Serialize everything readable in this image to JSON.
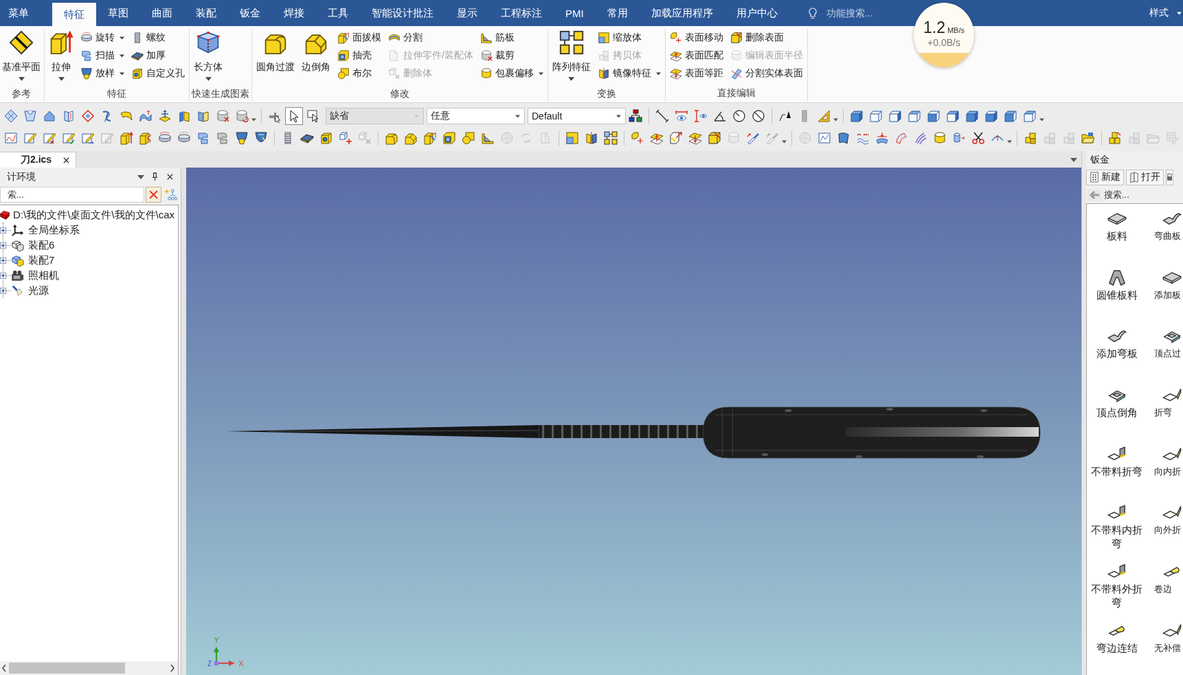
{
  "menubar": {
    "tabs": [
      {
        "label": "菜单",
        "selected": false
      },
      {
        "label": "特征",
        "selected": true
      },
      {
        "label": "草图",
        "selected": false
      },
      {
        "label": "曲面",
        "selected": false
      },
      {
        "label": "装配",
        "selected": false
      },
      {
        "label": "钣金",
        "selected": false
      },
      {
        "label": "焊接",
        "selected": false
      },
      {
        "label": "工具",
        "selected": false
      },
      {
        "label": "智能设计批注",
        "selected": false
      },
      {
        "label": "显示",
        "selected": false
      },
      {
        "label": "工程标注",
        "selected": false
      },
      {
        "label": "PMI",
        "selected": false
      },
      {
        "label": "常用",
        "selected": false
      },
      {
        "label": "加载应用程序",
        "selected": false
      },
      {
        "label": "用户中心",
        "selected": false
      }
    ],
    "search": {
      "placeholder": "功能搜索..."
    },
    "style_menu": {
      "label": "样式"
    }
  },
  "speed_meter": {
    "rate": "1.2",
    "unit": "MB/s",
    "change": "+0.0B/s",
    "level": 0.22
  },
  "ribbon": {
    "groups": [
      {
        "label": "参考",
        "items": [
          {
            "kind": "large",
            "label": "基准平面",
            "menu": true,
            "disabled": false
          }
        ]
      },
      {
        "label": "特征",
        "items": [
          {
            "kind": "large",
            "label": "拉伸",
            "menu": true,
            "disabled": false
          },
          {
            "kind": "small",
            "label": "旋转",
            "menu": true,
            "disabled": false
          },
          {
            "kind": "small",
            "label": "扫描",
            "menu": true,
            "disabled": false
          },
          {
            "kind": "small",
            "label": "放样",
            "menu": true,
            "disabled": false
          },
          {
            "kind": "small",
            "label": "螺纹",
            "menu": false,
            "disabled": false
          },
          {
            "kind": "small",
            "label": "加厚",
            "menu": false,
            "disabled": false
          },
          {
            "kind": "small",
            "label": "自定义孔",
            "menu": false,
            "disabled": false
          }
        ]
      },
      {
        "label": "快速生成图素",
        "items": [
          {
            "kind": "large",
            "label": "长方体",
            "menu": true,
            "disabled": false
          }
        ]
      },
      {
        "label": "修改",
        "items": [
          {
            "kind": "large",
            "label": "圆角过渡",
            "menu": false,
            "disabled": false
          },
          {
            "kind": "large",
            "label": "边倒角",
            "menu": false,
            "disabled": false
          },
          {
            "kind": "small",
            "label": "面拔模",
            "menu": false,
            "disabled": false
          },
          {
            "kind": "small",
            "label": "抽壳",
            "menu": false,
            "disabled": false
          },
          {
            "kind": "small",
            "label": "布尔",
            "menu": false,
            "disabled": false
          },
          {
            "kind": "small",
            "label": "分割",
            "menu": false,
            "disabled": false
          },
          {
            "kind": "small",
            "label": "拉伸零件/装配体",
            "menu": false,
            "disabled": true
          },
          {
            "kind": "small",
            "label": "删除体",
            "menu": false,
            "disabled": true
          },
          {
            "kind": "small",
            "label": "筋板",
            "menu": false,
            "disabled": false
          },
          {
            "kind": "small",
            "label": "裁剪",
            "menu": false,
            "disabled": false
          },
          {
            "kind": "small",
            "label": "包裹偏移",
            "menu": true,
            "disabled": false
          }
        ]
      },
      {
        "label": "变换",
        "items": [
          {
            "kind": "large",
            "label": "阵列特征",
            "menu": true,
            "disabled": false
          },
          {
            "kind": "small",
            "label": "缩放体",
            "menu": false,
            "disabled": false
          },
          {
            "kind": "small",
            "label": "拷贝体",
            "menu": false,
            "disabled": true
          },
          {
            "kind": "small",
            "label": "镜像特征",
            "menu": true,
            "disabled": false
          }
        ]
      },
      {
        "label": "直接编辑",
        "items": [
          {
            "kind": "small",
            "label": "表面移动",
            "menu": false,
            "disabled": false
          },
          {
            "kind": "small",
            "label": "表面匹配",
            "menu": false,
            "disabled": false
          },
          {
            "kind": "small",
            "label": "表面等距",
            "menu": false,
            "disabled": false
          },
          {
            "kind": "small",
            "label": "删除表面",
            "menu": false,
            "disabled": false
          },
          {
            "kind": "small",
            "label": "编辑表面半径",
            "menu": false,
            "disabled": true
          },
          {
            "kind": "small",
            "label": "分割实体表面",
            "menu": false,
            "disabled": false
          }
        ]
      }
    ]
  },
  "toolbar_rows": [
    {
      "segments": [
        {
          "kind": "icons",
          "menu": true,
          "buttons": [
            {
              "disabled": false
            },
            {
              "disabled": false
            },
            {
              "disabled": false
            },
            {
              "disabled": false
            },
            {
              "disabled": false
            },
            {
              "disabled": false
            },
            {
              "disabled": false
            },
            {
              "disabled": false
            },
            {
              "disabled": false
            },
            {
              "disabled": false
            },
            {
              "disabled": false
            },
            {
              "disabled": false
            },
            {
              "disabled": false
            }
          ]
        },
        {
          "kind": "toggles",
          "menu": false,
          "buttons": [
            {
              "selected": false
            },
            {
              "selected": true
            },
            {
              "selected": false
            }
          ]
        },
        {
          "kind": "dropdowns",
          "menu": false,
          "fields": [
            {
              "value": "缺省",
              "disabled": true
            },
            {
              "value": "任意",
              "disabled": false
            },
            {
              "value": "Default",
              "disabled": false
            }
          ]
        },
        {
          "kind": "icons",
          "menu": false,
          "buttons": [
            {
              "disabled": false
            }
          ]
        },
        {
          "kind": "icons",
          "menu": false,
          "buttons": [
            {
              "disabled": false
            },
            {
              "disabled": false
            },
            {
              "disabled": false
            },
            {
              "disabled": false
            },
            {
              "disabled": false
            },
            {
              "disabled": false
            }
          ]
        },
        {
          "kind": "icons",
          "menu": true,
          "buttons": [
            {
              "disabled": false
            },
            {
              "disabled": false
            },
            {
              "disabled": false
            }
          ]
        },
        {
          "kind": "icons",
          "menu": true,
          "buttons": [
            {
              "disabled": false
            },
            {
              "disabled": false
            },
            {
              "disabled": false
            },
            {
              "disabled": false
            },
            {
              "disabled": false
            },
            {
              "disabled": false
            },
            {
              "disabled": false
            },
            {
              "disabled": false
            },
            {
              "disabled": false
            },
            {
              "disabled": false
            }
          ]
        }
      ]
    },
    {
      "segments": [
        {
          "kind": "icons",
          "menu": false,
          "buttons": [
            {
              "disabled": false
            },
            {
              "disabled": false
            },
            {
              "disabled": false
            },
            {
              "disabled": false
            },
            {
              "disabled": false
            },
            {
              "disabled": true
            },
            {
              "disabled": false
            },
            {
              "disabled": false
            },
            {
              "disabled": false
            },
            {
              "disabled": false
            },
            {
              "disabled": false
            },
            {
              "disabled": false
            },
            {
              "disabled": false
            },
            {
              "disabled": false
            }
          ]
        },
        {
          "kind": "icons",
          "menu": false,
          "buttons": [
            {
              "disabled": false
            },
            {
              "disabled": false
            },
            {
              "disabled": false
            },
            {
              "disabled": false
            },
            {
              "disabled": true
            }
          ]
        },
        {
          "kind": "icons",
          "menu": false,
          "buttons": [
            {
              "disabled": false
            },
            {
              "disabled": false
            },
            {
              "disabled": false
            },
            {
              "disabled": false
            },
            {
              "disabled": false
            },
            {
              "disabled": false
            },
            {
              "disabled": true
            },
            {
              "disabled": true
            },
            {
              "disabled": true
            }
          ]
        },
        {
          "kind": "icons",
          "menu": false,
          "buttons": [
            {
              "disabled": false
            },
            {
              "disabled": false
            },
            {
              "disabled": false
            }
          ]
        },
        {
          "kind": "icons",
          "menu": true,
          "buttons": [
            {
              "disabled": false
            },
            {
              "disabled": false
            },
            {
              "disabled": false
            },
            {
              "disabled": false
            },
            {
              "disabled": false
            },
            {
              "disabled": true
            },
            {
              "disabled": false
            },
            {
              "disabled": true
            }
          ]
        },
        {
          "kind": "icons",
          "menu": true,
          "buttons": [
            {
              "disabled": true
            },
            {
              "disabled": false
            },
            {
              "disabled": false
            },
            {
              "disabled": false
            },
            {
              "disabled": false
            },
            {
              "disabled": false
            },
            {
              "disabled": false
            },
            {
              "disabled": false
            },
            {
              "disabled": false
            },
            {
              "disabled": false
            },
            {
              "disabled": false
            }
          ]
        },
        {
          "kind": "icons",
          "menu": false,
          "buttons": [
            {
              "disabled": false
            },
            {
              "disabled": true
            },
            {
              "disabled": true
            },
            {
              "disabled": false
            }
          ]
        },
        {
          "kind": "icons",
          "menu": false,
          "buttons": [
            {
              "disabled": false
            },
            {
              "disabled": true
            },
            {
              "disabled": true
            },
            {
              "disabled": true
            }
          ]
        }
      ]
    }
  ],
  "document_tabs": [
    {
      "label": "刀2.ics",
      "selected": true
    }
  ],
  "design_panel": {
    "title": "计环境",
    "search": {
      "placeholder": "索..."
    },
    "tree": [
      {
        "label": "D:\\我的文件\\桌面文件\\我的文件\\cax",
        "children": [
          {
            "label": "全局坐标系",
            "expanded": false
          },
          {
            "label": "装配6",
            "expanded": false
          },
          {
            "label": "装配7",
            "expanded": false
          },
          {
            "label": "照相机",
            "expanded": false
          },
          {
            "label": "光源",
            "expanded": false
          }
        ]
      }
    ]
  },
  "viewport": {
    "axes": [
      {
        "label": "Y"
      },
      {
        "label": "Z"
      },
      {
        "label": "X"
      }
    ]
  },
  "sheet_metal_panel": {
    "title": "钣金",
    "buttons": [
      {
        "label": "新建"
      },
      {
        "label": "打开"
      }
    ],
    "search": {
      "placeholder": "搜索..."
    },
    "items": [
      {
        "label": "板料"
      },
      {
        "label": "弯曲板"
      },
      {
        "label": "圆锥板料"
      },
      {
        "label": "添加板"
      },
      {
        "label": "添加弯板"
      },
      {
        "label": "顶点过"
      },
      {
        "label": "顶点倒角"
      },
      {
        "label": "折弯"
      },
      {
        "label": "不带料折弯"
      },
      {
        "label": "向内折"
      },
      {
        "label": "不带料内折弯"
      },
      {
        "label": "向外折"
      },
      {
        "label": "不带料外折弯"
      },
      {
        "label": "卷边"
      },
      {
        "label": "弯边连结"
      },
      {
        "label": "无补偿"
      }
    ]
  }
}
